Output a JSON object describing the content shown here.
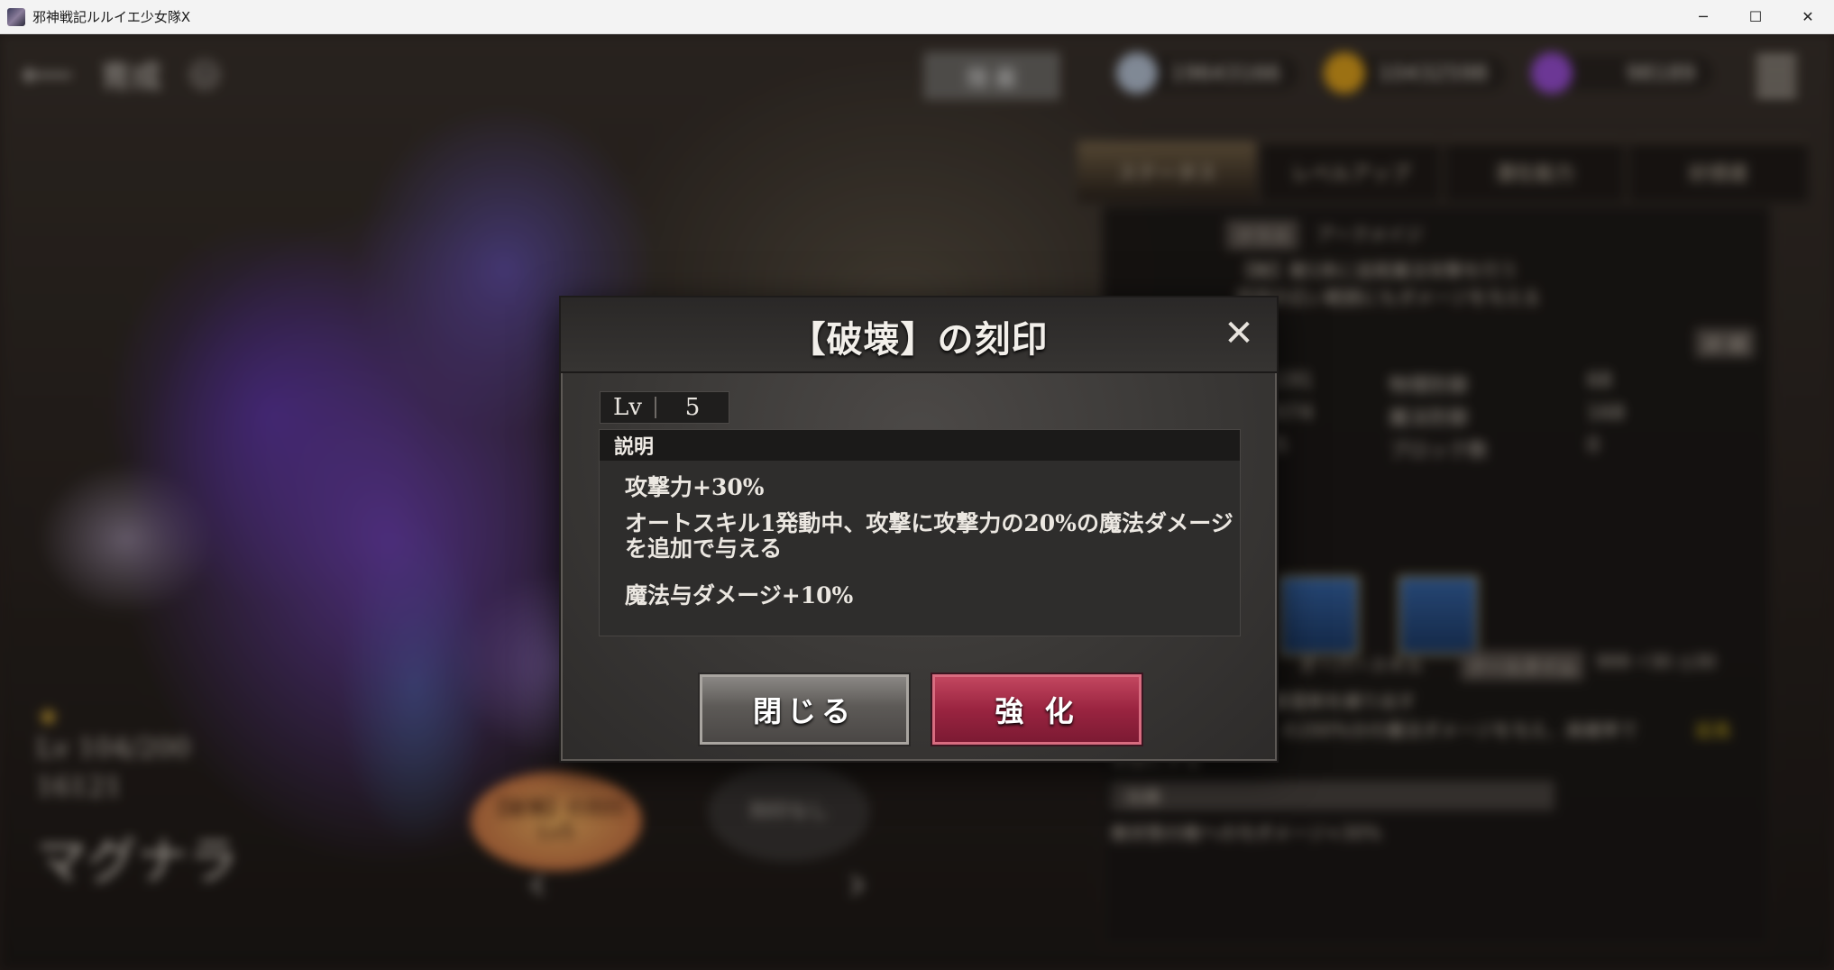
{
  "window": {
    "title": "邪神戦記ルルイエ少女隊X",
    "minimize": "─",
    "maximize": "☐",
    "close": "✕"
  },
  "game": {
    "screen_title": "育成",
    "help": "?",
    "hide_button": "隠 蔽",
    "currencies": [
      {
        "icon": "crystal-icon",
        "value": "19643166",
        "color": "#b8c4d6"
      },
      {
        "icon": "gold-coin-icon",
        "value": "10432598",
        "color": "#e0a21c"
      },
      {
        "icon": "purple-gem-icon",
        "value": "98189",
        "color": "#9b4fd6"
      }
    ],
    "tabs": [
      "ステータス",
      "レベルアップ",
      "潜在能力",
      "好感度"
    ],
    "class_tag": "クラス",
    "class_name": "アークメイジ",
    "class_desc_1": "【敵】敵1体に追尾魔法攻撃を行う",
    "class_desc_2": "周囲の広い範囲にもダメージを与える",
    "detail_btn": "詳 細",
    "stats": [
      {
        "v1": "1191",
        "k": "物理防御",
        "v2": "68"
      },
      {
        "v1": "2074",
        "k": "魔法防御",
        "v2": "168"
      },
      {
        "v1": "95",
        "k": "ブロック数",
        "v2": "0"
      }
    ],
    "overskill_label": "オーバースキル",
    "cooldown_label": "クールタイム",
    "overskill_vals": "999 ⚡30 ◷30",
    "skill_text_1": "雷霆剣を繰り出す",
    "skill_text_2": "の200%分の魔法ダメージを与え、高確率で",
    "skill_highlight": "延長",
    "skill_text_3": "状態にする",
    "effect_header": "効果",
    "effect_text": "敵状態の敵への与ダメージ+30%",
    "char_level": "Lv 104/200",
    "char_power": "16121",
    "char_name": "マグナラ",
    "seal_bubble": "【破壊】の刻印\nLv5",
    "no_seal_bubble": "刻印なし"
  },
  "dialog": {
    "title": "【破壊】の刻印",
    "close_icon": "✕",
    "lv_label": "Lv",
    "lv_value": "5",
    "desc_header": "説明",
    "desc_lines": [
      "攻撃力+30%",
      "オートスキル1発動中、攻撃に攻撃力の20%の魔法ダメージ",
      "を追加で与える",
      "魔法与ダメージ+10%"
    ],
    "btn_close": "閉じる",
    "btn_enhance": "強 化"
  }
}
